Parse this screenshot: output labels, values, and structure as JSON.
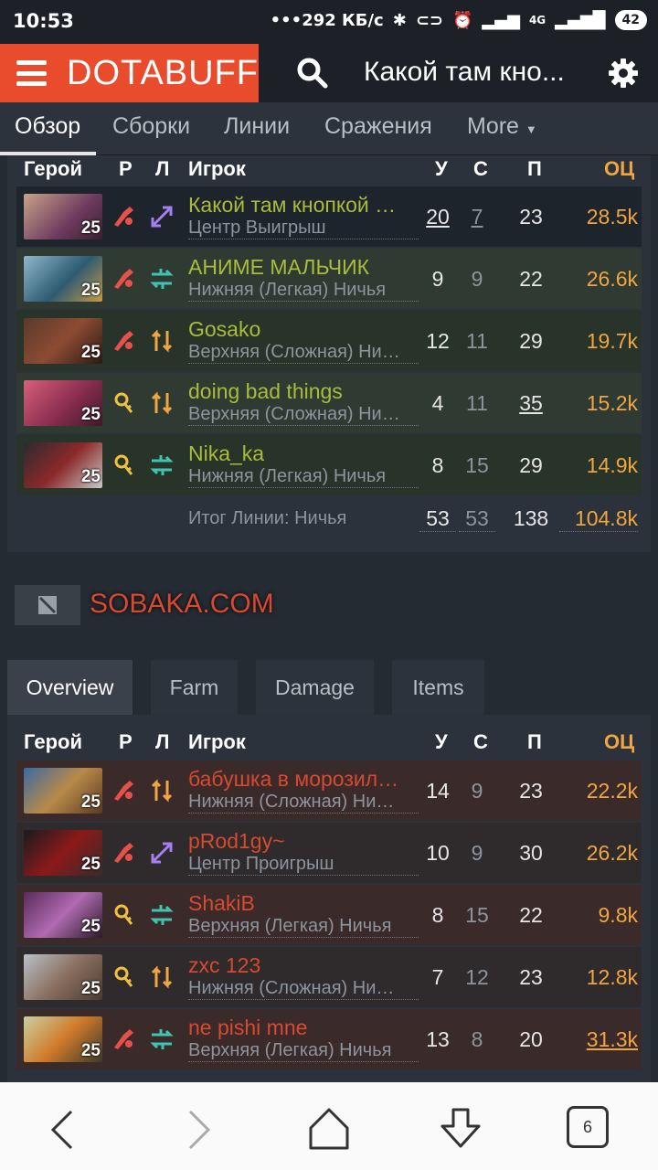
{
  "status": {
    "time": "10:53",
    "speed": "292 КБ/с",
    "network": "4G",
    "battery": "42"
  },
  "header": {
    "logo": "DOTABUFF",
    "title": "Какой там кно..."
  },
  "tabs": [
    "Обзор",
    "Сборки",
    "Линии",
    "Сражения",
    "More"
  ],
  "table_header": {
    "hero": "Герой",
    "role": "Р",
    "lane": "Л",
    "player": "Игрок",
    "kills": "У",
    "deaths": "С",
    "assists": "П",
    "networth": "ОЦ"
  },
  "radiant": {
    "players": [
      {
        "name": "Какой там кнопкой …",
        "lane": "Центр Выигрыш",
        "level": "25",
        "kills": "20",
        "deaths": "7",
        "assists": "23",
        "networth": "28.5k"
      },
      {
        "name": "АНИМЕ МАЛЬЧИК",
        "lane": "Нижняя (Легкая) Ничья",
        "level": "25",
        "kills": "9",
        "deaths": "9",
        "assists": "22",
        "networth": "26.6k"
      },
      {
        "name": "Gosako",
        "lane": "Верхняя (Сложная) Ни…",
        "level": "25",
        "kills": "12",
        "deaths": "11",
        "assists": "29",
        "networth": "19.7k"
      },
      {
        "name": "doing bad things",
        "lane": "Верхняя (Сложная) Ни…",
        "level": "25",
        "kills": "4",
        "deaths": "11",
        "assists": "35",
        "networth": "15.2k"
      },
      {
        "name": "Nika_ka",
        "lane": "Нижняя (Легкая) Ничья",
        "level": "25",
        "kills": "8",
        "deaths": "15",
        "assists": "29",
        "networth": "14.9k"
      }
    ],
    "summary": {
      "label": "Итог Линии: Ничья",
      "kills": "53",
      "deaths": "53",
      "assists": "138",
      "networth": "104.8k"
    }
  },
  "dire": {
    "team_name": "SOBAKA.COM",
    "tabs": [
      "Overview",
      "Farm",
      "Damage",
      "Items"
    ],
    "players": [
      {
        "name": "бабушка в морозил…",
        "lane": "Нижняя (Сложная) Ни…",
        "level": "25",
        "kills": "14",
        "deaths": "9",
        "assists": "23",
        "networth": "22.2k"
      },
      {
        "name": "pRod1gy~",
        "lane": "Центр Проигрыш",
        "level": "25",
        "kills": "10",
        "deaths": "9",
        "assists": "30",
        "networth": "26.2k"
      },
      {
        "name": "ShakiB",
        "lane": "Верхняя (Легкая) Ничья",
        "level": "25",
        "kills": "8",
        "deaths": "15",
        "assists": "22",
        "networth": "9.8k"
      },
      {
        "name": "zxc 123",
        "lane": "Нижняя (Сложная) Ни…",
        "level": "25",
        "kills": "7",
        "deaths": "12",
        "assists": "23",
        "networth": "12.8k"
      },
      {
        "name": "ne pishi mne",
        "lane": "Верхняя (Легкая) Ничья",
        "level": "25",
        "kills": "13",
        "deaths": "8",
        "assists": "20",
        "networth": "31.3k"
      }
    ]
  },
  "browser": {
    "tab_count": "6"
  }
}
